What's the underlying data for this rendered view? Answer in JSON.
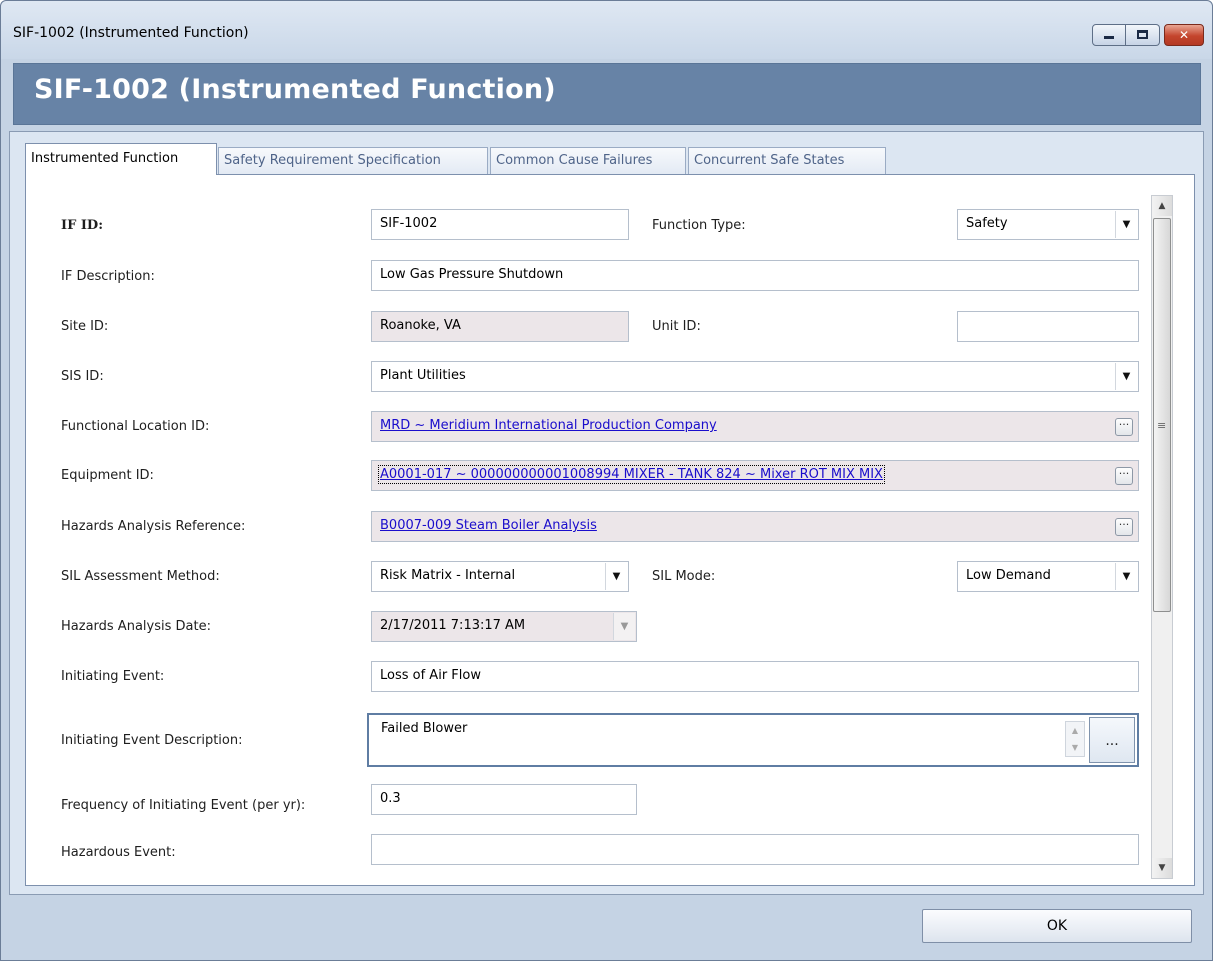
{
  "window": {
    "title": "SIF-1002 (Instrumented Function)",
    "header": "SIF-1002 (Instrumented Function)",
    "minimize_glyph": "",
    "maximize_glyph": "",
    "close_glyph": "✕"
  },
  "tabs": [
    {
      "label": "Instrumented Function",
      "active": true
    },
    {
      "label": "Safety Requirement Specification",
      "active": false
    },
    {
      "label": "Common Cause Failures",
      "active": false
    },
    {
      "label": "Concurrent Safe States",
      "active": false
    }
  ],
  "form": {
    "if_id": {
      "label": "IF ID:",
      "value": "SIF-1002"
    },
    "function_type": {
      "label": "Function Type:",
      "value": "Safety"
    },
    "if_description": {
      "label": "IF Description:",
      "value": "Low Gas Pressure Shutdown"
    },
    "site_id": {
      "label": "Site ID:",
      "value": "Roanoke, VA"
    },
    "unit_id": {
      "label": "Unit ID:",
      "value": ""
    },
    "sis_id": {
      "label": "SIS ID:",
      "value": "Plant Utilities"
    },
    "functional_location_id": {
      "label": "Functional Location ID:",
      "value": "MRD ~ Meridium International Production Company"
    },
    "equipment_id": {
      "label": "Equipment ID:",
      "value": "A0001-017 ~ 000000000001008994 MIXER - TANK 824 ~ Mixer ROT MIX MIX"
    },
    "hazards_analysis_reference": {
      "label": "Hazards Analysis Reference:",
      "value": "B0007-009 Steam Boiler Analysis"
    },
    "sil_assessment_method": {
      "label": "SIL Assessment Method:",
      "value": "Risk Matrix - Internal"
    },
    "sil_mode": {
      "label": "SIL Mode:",
      "value": "Low Demand"
    },
    "hazards_analysis_date": {
      "label": "Hazards Analysis Date:",
      "value": "2/17/2011 7:13:17 AM"
    },
    "initiating_event": {
      "label": "Initiating Event:",
      "value": "Loss of Air Flow"
    },
    "initiating_event_description": {
      "label": "Initiating Event Description:",
      "value": "Failed Blower"
    },
    "frequency_of_initiating_event": {
      "label": "Frequency of Initiating Event (per yr):",
      "value": "0.3"
    },
    "hazardous_event": {
      "label": "Hazardous Event:",
      "value": ""
    }
  },
  "glyphs": {
    "dropdown": "▼",
    "ellipsis": "···",
    "memo_ellipsis": "...",
    "up": "▲",
    "down": "▼",
    "grip": "≡"
  },
  "buttons": {
    "ok": "OK"
  }
}
